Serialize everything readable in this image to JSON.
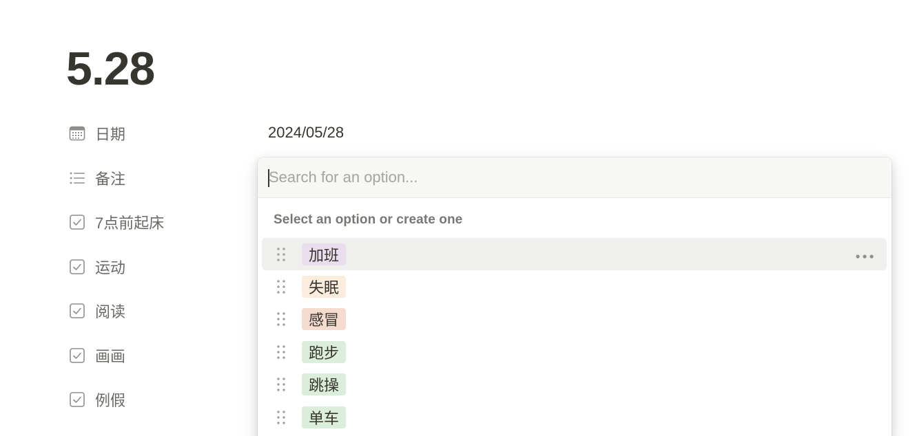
{
  "page": {
    "title": "5.28"
  },
  "properties": [
    {
      "label": "日期",
      "icon": "calendar-icon"
    },
    {
      "label": "备注",
      "icon": "list-icon"
    },
    {
      "label": "7点前起床",
      "icon": "checkbox-icon"
    },
    {
      "label": "运动",
      "icon": "checkbox-icon"
    },
    {
      "label": "阅读",
      "icon": "checkbox-icon"
    },
    {
      "label": "画画",
      "icon": "checkbox-icon"
    },
    {
      "label": "例假",
      "icon": "checkbox-icon"
    }
  ],
  "date_value": "2024/05/28",
  "dropdown": {
    "search_placeholder": "Search for an option...",
    "search_value": "",
    "hint": "Select an option or create one",
    "options": [
      {
        "label": "加班",
        "color": "#e8deee",
        "active": true
      },
      {
        "label": "失眠",
        "color": "#fbecdd",
        "active": false
      },
      {
        "label": "感冒",
        "color": "#f5dccf",
        "active": false
      },
      {
        "label": "跑步",
        "color": "#dbeddb",
        "active": false
      },
      {
        "label": "跳操",
        "color": "#dbeddb",
        "active": false
      },
      {
        "label": "单车",
        "color": "#dbeddb",
        "active": false
      }
    ],
    "more_icon": "more-horizontal-icon",
    "drag_icon": "drag-handle-icon"
  }
}
